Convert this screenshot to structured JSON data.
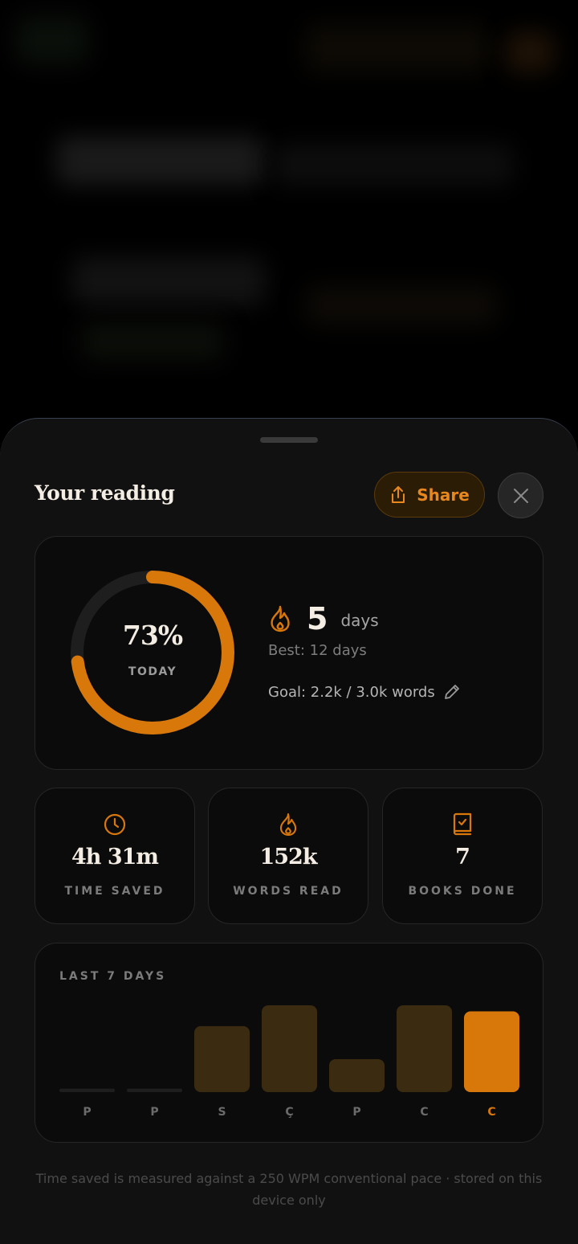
{
  "sheet": {
    "title": "Your reading",
    "share_label": "Share"
  },
  "progress": {
    "percent_label": "73%",
    "percent_value": 73,
    "caption": "TODAY"
  },
  "streak": {
    "value": "5",
    "unit": "days",
    "best": "Best: 12 days"
  },
  "goal": {
    "text": "Goal: 2.2k / 3.0k words"
  },
  "stats": [
    {
      "icon": "clock-icon",
      "value": "4h 31m",
      "label": "TIME SAVED"
    },
    {
      "icon": "flame-icon",
      "value": "152k",
      "label": "WORDS READ"
    },
    {
      "icon": "book-check-icon",
      "value": "7",
      "label": "BOOKS DONE"
    }
  ],
  "chart_data": {
    "type": "bar",
    "title": "LAST 7 DAYS",
    "categories": [
      "P",
      "P",
      "S",
      "Ç",
      "P",
      "C",
      "C"
    ],
    "values": [
      0.04,
      0.04,
      0.76,
      1.0,
      0.38,
      1.0,
      0.93
    ],
    "highlight_index": 6
  },
  "footnote": "Time saved is measured against a 250 WPM conventional pace · stored on this device only",
  "colors": {
    "accent": "#d9780a",
    "bar_muted": "#3b2b10",
    "bar_empty": "#1e1e1e",
    "ring_track": "#1e1e1e"
  }
}
